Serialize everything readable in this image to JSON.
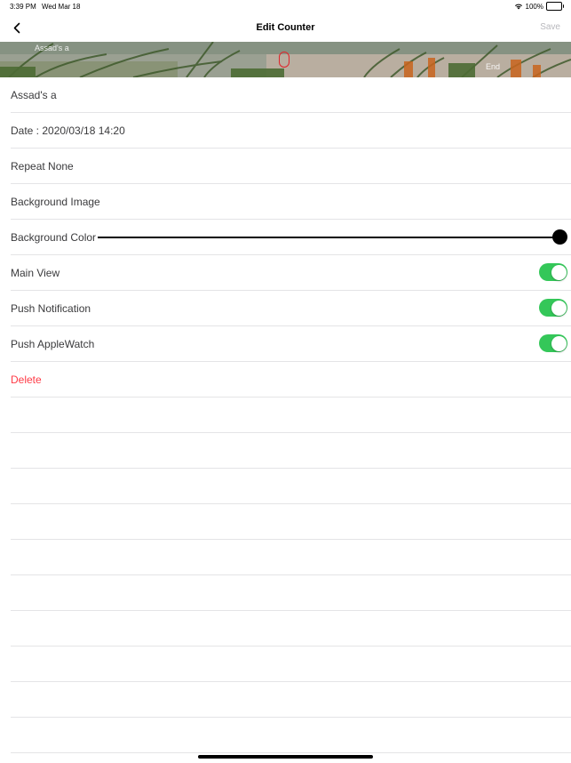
{
  "status_bar": {
    "time": "3:39 PM",
    "date": "Wed Mar 18",
    "battery": "100%",
    "wifi_icon": "wifi-icon",
    "battery_icon": "battery-icon"
  },
  "nav": {
    "back_icon": "chevron-left-icon",
    "title": "Edit Counter",
    "save_label": "Save"
  },
  "banner": {
    "title": "Assad's a",
    "count": "0",
    "count_color": "#e0242a",
    "end_label": "End"
  },
  "rows": {
    "name": "Assad's a",
    "date": "Date : 2020/03/18 14:20",
    "repeat": "Repeat None",
    "background_image": "Background Image",
    "background_color": "Background Color",
    "main_view": "Main View",
    "push_notification": "Push Notification",
    "push_applewatch": "Push AppleWatch",
    "delete": "Delete"
  },
  "toggles": {
    "main_view_on": true,
    "push_notification_on": true,
    "push_applewatch_on": true,
    "on_color": "#34c759"
  },
  "colors": {
    "delete": "#ff3b46",
    "background_color_slider": "#000000"
  }
}
